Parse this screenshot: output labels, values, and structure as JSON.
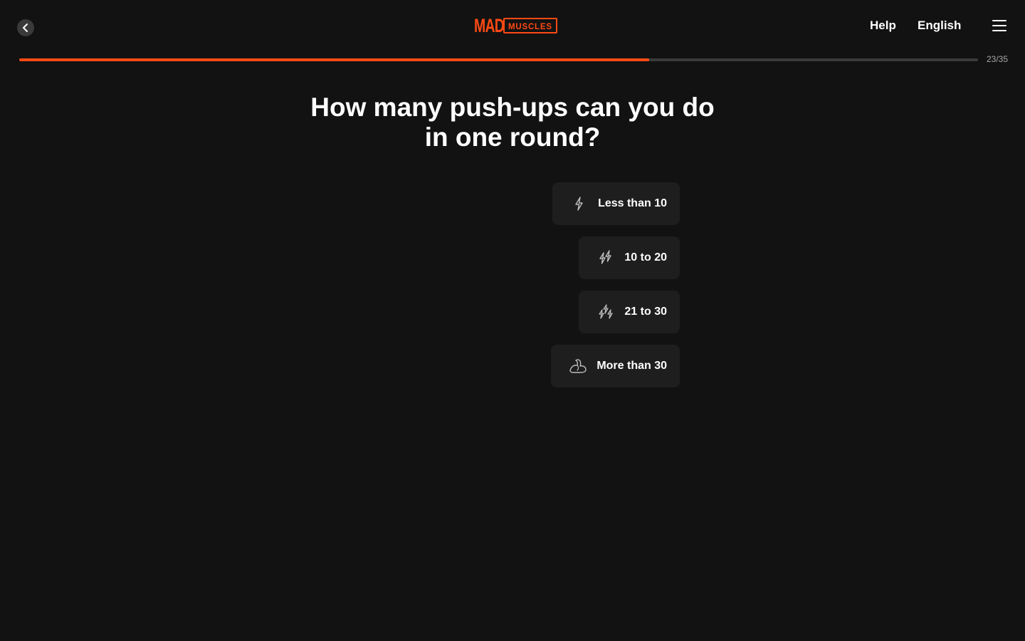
{
  "header": {
    "logo_primary": "MAD",
    "logo_secondary": "MUSCLES",
    "help_label": "Help",
    "language_label": "English"
  },
  "progress": {
    "current": 23,
    "total": 35,
    "label": "23/35"
  },
  "question": {
    "title": "How many push-ups can you do in one round?"
  },
  "options": [
    {
      "label": "Less than 10",
      "icon": "bolt-icon"
    },
    {
      "label": "10 to 20",
      "icon": "double-bolt-icon"
    },
    {
      "label": "21 to 30",
      "icon": "triple-bolt-icon"
    },
    {
      "label": "More than 30",
      "icon": "flexed-biceps-icon"
    }
  ],
  "colors": {
    "accent": "#ff4a14",
    "background": "#121212",
    "card": "#1e1e1e",
    "track": "#3a3a3a"
  }
}
